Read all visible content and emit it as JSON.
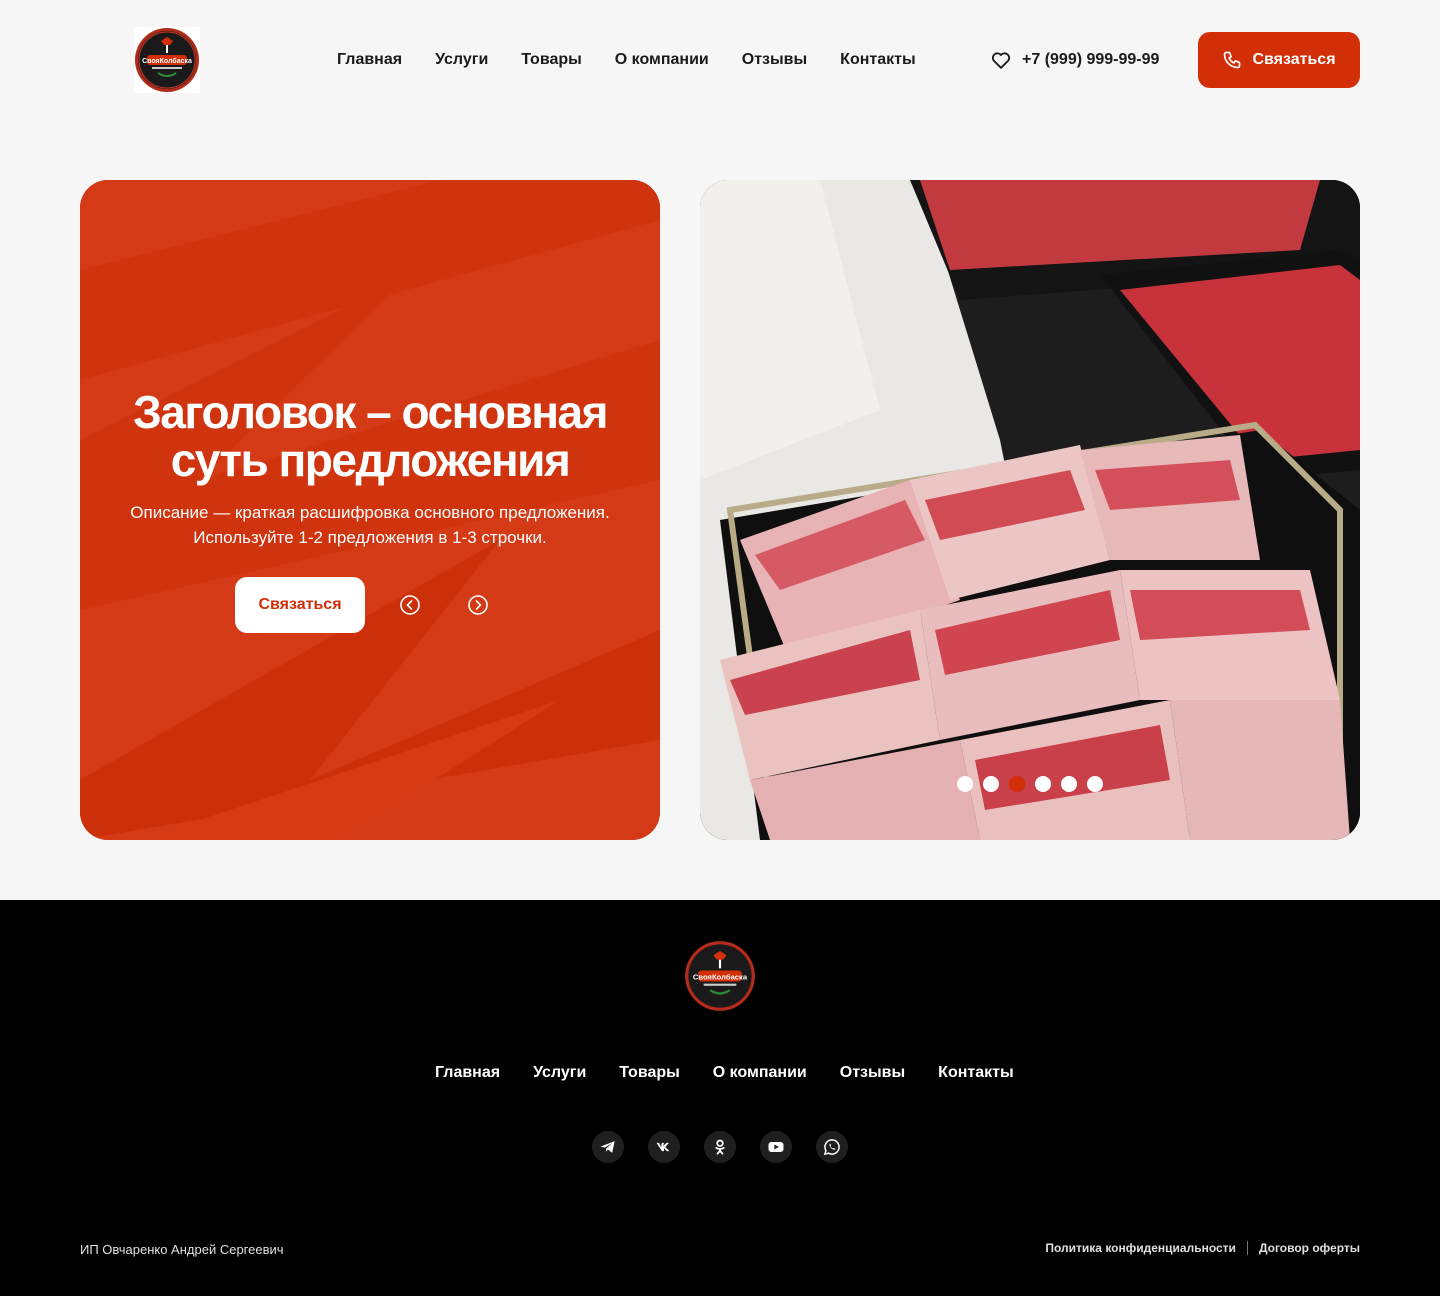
{
  "brand": {
    "logo_name": "СвояКолбаска",
    "logo_icon": "sausage-logo"
  },
  "header": {
    "nav": [
      "Главная",
      "Услуги",
      "Товары",
      "О компании",
      "Отзывы",
      "Контакты"
    ],
    "favorites_icon": "heart-icon",
    "phone": "+7 (999) 999-99-99",
    "contact_button": "Связаться",
    "contact_icon": "phone-icon"
  },
  "hero": {
    "title": "Заголовок – основная суть предложения",
    "description": "Описание — краткая расшифровка основного предложения. Используйте 1-2 предложения в 1-3 строчки.",
    "cta": "Связаться",
    "prev_icon": "chevron-left-circle-icon",
    "next_icon": "chevron-right-circle-icon",
    "slides_total": 6,
    "slide_active": 3
  },
  "footer": {
    "nav": [
      "Главная",
      "Услуги",
      "Товары",
      "О компании",
      "Отзывы",
      "Контакты"
    ],
    "socials": [
      "telegram-icon",
      "vk-icon",
      "odnoklassniki-icon",
      "youtube-icon",
      "whatsapp-icon"
    ],
    "copyright": "ИП Овчаренко Андрей Сергеевич",
    "privacy": "Политика конфиденциальности",
    "offer": "Договор оферты"
  },
  "colors": {
    "accent": "#d22e07",
    "hero_bg": "#d53a14",
    "page_bg": "#f6f6f6",
    "footer_bg": "#000000"
  }
}
